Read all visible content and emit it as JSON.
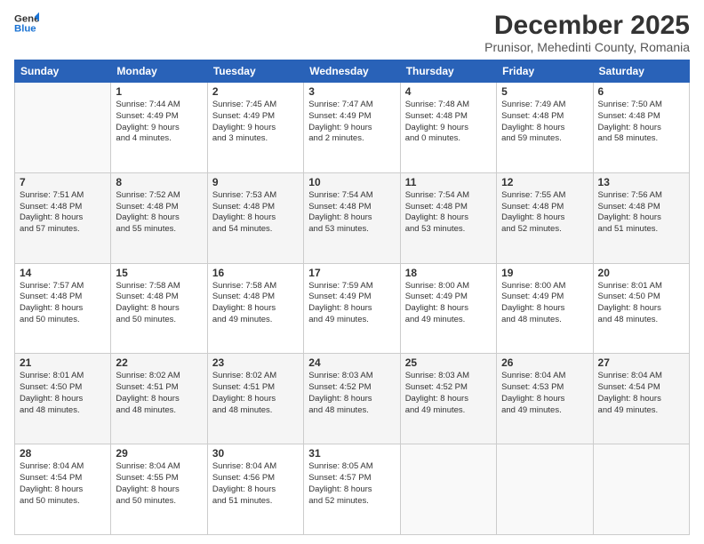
{
  "logo": {
    "line1": "General",
    "line2": "Blue"
  },
  "title": "December 2025",
  "subtitle": "Prunisor, Mehedinti County, Romania",
  "days": [
    "Sunday",
    "Monday",
    "Tuesday",
    "Wednesday",
    "Thursday",
    "Friday",
    "Saturday"
  ],
  "weeks": [
    [
      {
        "date": "",
        "info": ""
      },
      {
        "date": "1",
        "info": "Sunrise: 7:44 AM\nSunset: 4:49 PM\nDaylight: 9 hours\nand 4 minutes."
      },
      {
        "date": "2",
        "info": "Sunrise: 7:45 AM\nSunset: 4:49 PM\nDaylight: 9 hours\nand 3 minutes."
      },
      {
        "date": "3",
        "info": "Sunrise: 7:47 AM\nSunset: 4:49 PM\nDaylight: 9 hours\nand 2 minutes."
      },
      {
        "date": "4",
        "info": "Sunrise: 7:48 AM\nSunset: 4:48 PM\nDaylight: 9 hours\nand 0 minutes."
      },
      {
        "date": "5",
        "info": "Sunrise: 7:49 AM\nSunset: 4:48 PM\nDaylight: 8 hours\nand 59 minutes."
      },
      {
        "date": "6",
        "info": "Sunrise: 7:50 AM\nSunset: 4:48 PM\nDaylight: 8 hours\nand 58 minutes."
      }
    ],
    [
      {
        "date": "7",
        "info": "Sunrise: 7:51 AM\nSunset: 4:48 PM\nDaylight: 8 hours\nand 57 minutes."
      },
      {
        "date": "8",
        "info": "Sunrise: 7:52 AM\nSunset: 4:48 PM\nDaylight: 8 hours\nand 55 minutes."
      },
      {
        "date": "9",
        "info": "Sunrise: 7:53 AM\nSunset: 4:48 PM\nDaylight: 8 hours\nand 54 minutes."
      },
      {
        "date": "10",
        "info": "Sunrise: 7:54 AM\nSunset: 4:48 PM\nDaylight: 8 hours\nand 53 minutes."
      },
      {
        "date": "11",
        "info": "Sunrise: 7:54 AM\nSunset: 4:48 PM\nDaylight: 8 hours\nand 53 minutes."
      },
      {
        "date": "12",
        "info": "Sunrise: 7:55 AM\nSunset: 4:48 PM\nDaylight: 8 hours\nand 52 minutes."
      },
      {
        "date": "13",
        "info": "Sunrise: 7:56 AM\nSunset: 4:48 PM\nDaylight: 8 hours\nand 51 minutes."
      }
    ],
    [
      {
        "date": "14",
        "info": "Sunrise: 7:57 AM\nSunset: 4:48 PM\nDaylight: 8 hours\nand 50 minutes."
      },
      {
        "date": "15",
        "info": "Sunrise: 7:58 AM\nSunset: 4:48 PM\nDaylight: 8 hours\nand 50 minutes."
      },
      {
        "date": "16",
        "info": "Sunrise: 7:58 AM\nSunset: 4:48 PM\nDaylight: 8 hours\nand 49 minutes."
      },
      {
        "date": "17",
        "info": "Sunrise: 7:59 AM\nSunset: 4:49 PM\nDaylight: 8 hours\nand 49 minutes."
      },
      {
        "date": "18",
        "info": "Sunrise: 8:00 AM\nSunset: 4:49 PM\nDaylight: 8 hours\nand 49 minutes."
      },
      {
        "date": "19",
        "info": "Sunrise: 8:00 AM\nSunset: 4:49 PM\nDaylight: 8 hours\nand 48 minutes."
      },
      {
        "date": "20",
        "info": "Sunrise: 8:01 AM\nSunset: 4:50 PM\nDaylight: 8 hours\nand 48 minutes."
      }
    ],
    [
      {
        "date": "21",
        "info": "Sunrise: 8:01 AM\nSunset: 4:50 PM\nDaylight: 8 hours\nand 48 minutes."
      },
      {
        "date": "22",
        "info": "Sunrise: 8:02 AM\nSunset: 4:51 PM\nDaylight: 8 hours\nand 48 minutes."
      },
      {
        "date": "23",
        "info": "Sunrise: 8:02 AM\nSunset: 4:51 PM\nDaylight: 8 hours\nand 48 minutes."
      },
      {
        "date": "24",
        "info": "Sunrise: 8:03 AM\nSunset: 4:52 PM\nDaylight: 8 hours\nand 48 minutes."
      },
      {
        "date": "25",
        "info": "Sunrise: 8:03 AM\nSunset: 4:52 PM\nDaylight: 8 hours\nand 49 minutes."
      },
      {
        "date": "26",
        "info": "Sunrise: 8:04 AM\nSunset: 4:53 PM\nDaylight: 8 hours\nand 49 minutes."
      },
      {
        "date": "27",
        "info": "Sunrise: 8:04 AM\nSunset: 4:54 PM\nDaylight: 8 hours\nand 49 minutes."
      }
    ],
    [
      {
        "date": "28",
        "info": "Sunrise: 8:04 AM\nSunset: 4:54 PM\nDaylight: 8 hours\nand 50 minutes."
      },
      {
        "date": "29",
        "info": "Sunrise: 8:04 AM\nSunset: 4:55 PM\nDaylight: 8 hours\nand 50 minutes."
      },
      {
        "date": "30",
        "info": "Sunrise: 8:04 AM\nSunset: 4:56 PM\nDaylight: 8 hours\nand 51 minutes."
      },
      {
        "date": "31",
        "info": "Sunrise: 8:05 AM\nSunset: 4:57 PM\nDaylight: 8 hours\nand 52 minutes."
      },
      {
        "date": "",
        "info": ""
      },
      {
        "date": "",
        "info": ""
      },
      {
        "date": "",
        "info": ""
      }
    ]
  ]
}
